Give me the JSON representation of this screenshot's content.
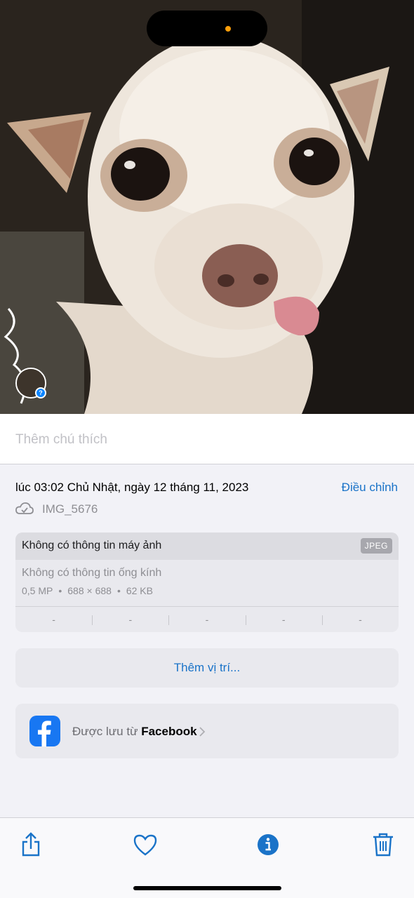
{
  "caption": {
    "placeholder": "Thêm chú thích"
  },
  "info": {
    "datetime": "lúc 03:02 Chủ Nhật, ngày 12 tháng 11, 2023",
    "adjust_label": "Điều chỉnh",
    "filename": "IMG_5676",
    "icon": "cloud-icon"
  },
  "exif": {
    "camera": "Không có thông tin máy ảnh",
    "format": "JPEG",
    "lens": "Không có thông tin ống kính",
    "resolution": "0,5 MP",
    "dimensions": "688 × 688",
    "size": "62 KB",
    "bullet": "•",
    "cells": [
      "-",
      "-",
      "-",
      "-",
      "-"
    ]
  },
  "location": {
    "label": "Thêm vị trí..."
  },
  "source": {
    "prefix": "Được lưu từ",
    "app": "Facebook",
    "icon": "facebook-icon"
  },
  "toolbar": {
    "items": [
      "share-icon",
      "heart-icon",
      "info-icon",
      "trash-icon"
    ]
  },
  "colors": {
    "accent": "#1a73c8",
    "facebook": "#1877f2",
    "status_dot": "#ff9f0a"
  }
}
